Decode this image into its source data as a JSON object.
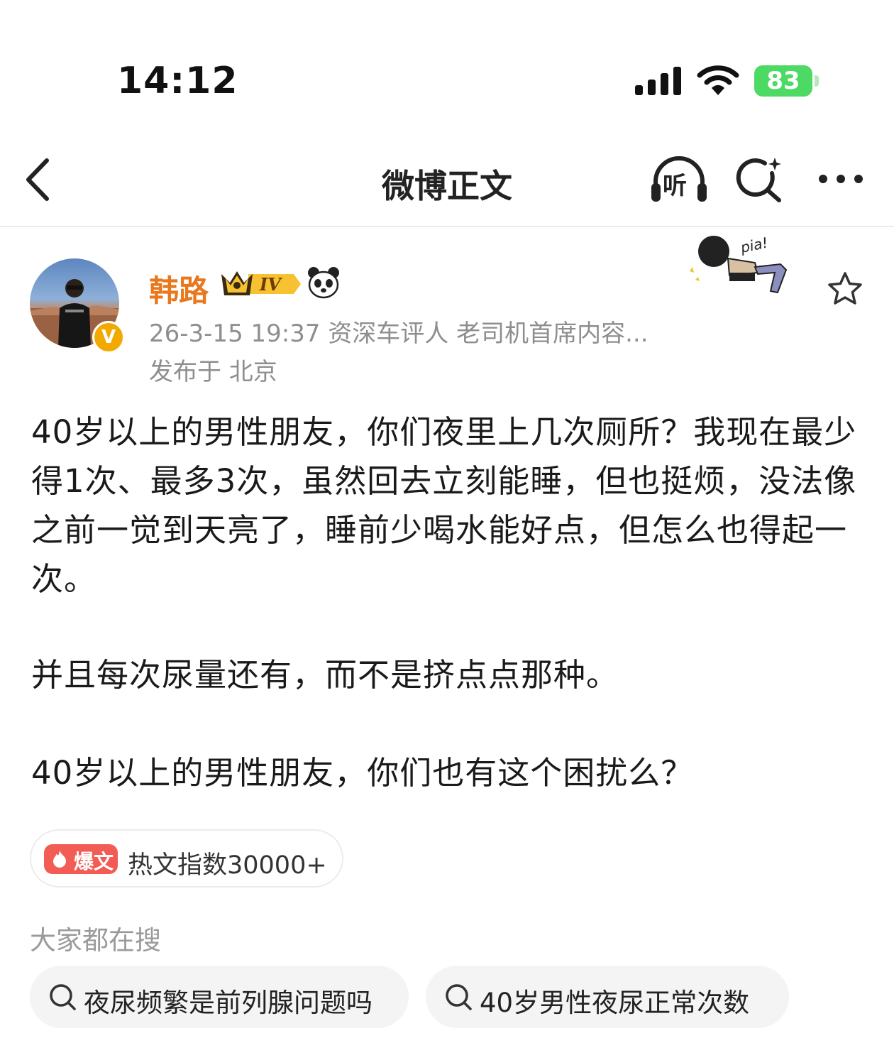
{
  "status_bar": {
    "time": "14:12",
    "battery": "83",
    "battery_color": "#4cd964"
  },
  "nav": {
    "title": "微博正文",
    "listen_label": "听",
    "icons": [
      "chevron-left-icon",
      "headphones-icon",
      "search-sparkle-icon",
      "more-icon"
    ]
  },
  "author": {
    "name": "韩路",
    "name_color": "#e8771d",
    "level_badge": "IV",
    "verified_mark": "V",
    "meta": "26-3-15 19:37  资深车评人 老司机首席内容...",
    "location": "发布于 北京",
    "sticker_text": "pia!"
  },
  "post": {
    "paragraphs": [
      "40岁以上的男性朋友，你们夜里上几次厕所？我现在最少得1次、最多3次，虽然回去立刻能睡，但也挺烦，没法像之前一觉到天亮了，睡前少喝水能好点，但怎么也得起一次。",
      "并且每次尿量还有，而不是挤点点那种。",
      "40岁以上的男性朋友，你们也有这个困扰么？"
    ]
  },
  "hot": {
    "tag": "爆文",
    "index": "热文指数30000+",
    "tag_color": "#f25c54"
  },
  "search": {
    "heading": "大家都在搜",
    "chips": [
      "夜尿频繁是前列腺问题吗",
      "40岁男性夜尿正常次数"
    ]
  }
}
